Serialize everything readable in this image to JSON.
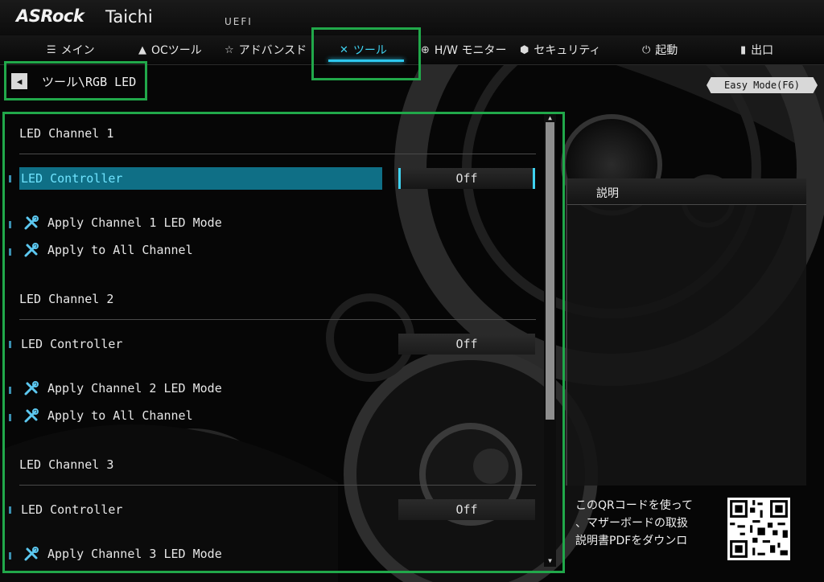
{
  "header": {
    "brand": "ASRock",
    "model": "Taichi",
    "firmware": "UEFI"
  },
  "nav": {
    "tabs": [
      {
        "label": "メイン",
        "icon": "list-icon"
      },
      {
        "label": "OCツール",
        "icon": "rocket-icon"
      },
      {
        "label": "アドバンスド",
        "icon": "star-icon"
      },
      {
        "label": "ツール",
        "icon": "tools-icon",
        "active": true
      },
      {
        "label": "H/W モニター",
        "icon": "crosshair-icon"
      },
      {
        "label": "セキュリティ",
        "icon": "shield-icon"
      },
      {
        "label": "起動",
        "icon": "power-icon"
      },
      {
        "label": "出口",
        "icon": "exit-door-icon"
      }
    ]
  },
  "breadcrumb": {
    "path": "ツール\\RGB LED"
  },
  "easy_mode": {
    "label": "Easy Mode(F6)"
  },
  "channels": [
    {
      "title": "LED Channel 1",
      "controller_label": "LED Controller",
      "controller_value": "Off",
      "apply_mode": "Apply Channel 1 LED Mode",
      "apply_all": "Apply to All Channel"
    },
    {
      "title": "LED Channel 2",
      "controller_label": "LED Controller",
      "controller_value": "Off",
      "apply_mode": "Apply Channel 2 LED Mode",
      "apply_all": "Apply to All Channel"
    },
    {
      "title": "LED Channel 3",
      "controller_label": "LED Controller",
      "controller_value": "Off",
      "apply_mode": "Apply Channel 3 LED Mode"
    }
  ],
  "description": {
    "title": "説明",
    "qr_text_line1": "このQRコードを使って",
    "qr_text_line2": "、マザーボードの取扱",
    "qr_text_line3": "説明書PDFをダウンロ"
  },
  "colors": {
    "accent": "#2ec8ee",
    "selected_bg": "#0f6f86",
    "highlight_box": "#21a84a"
  }
}
